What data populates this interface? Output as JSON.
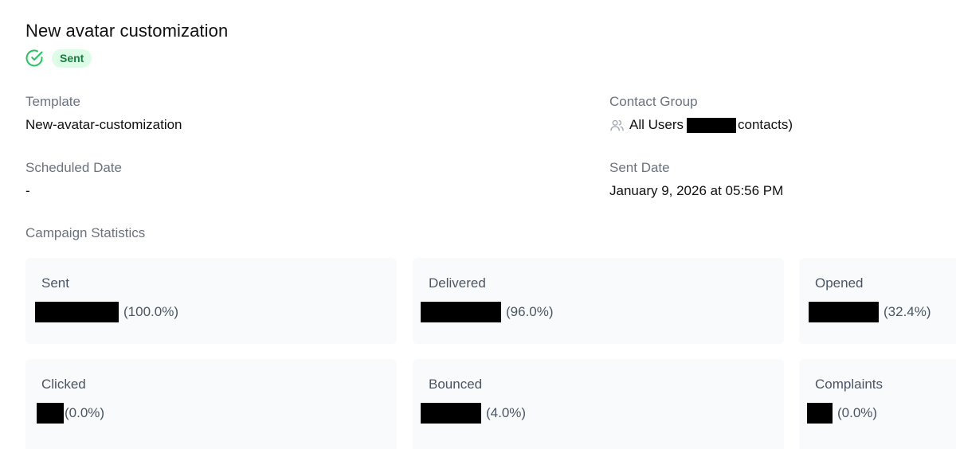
{
  "page": {
    "title": "New avatar customization",
    "status": "Sent"
  },
  "details": {
    "template": {
      "label": "Template",
      "value": "New-avatar-customization"
    },
    "contact_group": {
      "label": "Contact Group",
      "group_name": "All Users",
      "suffix": "contacts)"
    },
    "scheduled_date": {
      "label": "Scheduled Date",
      "value": "-"
    },
    "sent_date": {
      "label": "Sent Date",
      "value": "January 9, 2026 at 05:56 PM"
    }
  },
  "stats": {
    "heading": "Campaign Statistics",
    "cards": [
      {
        "label": "Sent",
        "percent": "(100.0%)"
      },
      {
        "label": "Delivered",
        "percent": "(96.0%)"
      },
      {
        "label": "Opened",
        "percent": "(32.4%)"
      },
      {
        "label": "Clicked",
        "percent": "(0.0%)"
      },
      {
        "label": "Bounced",
        "percent": "(4.0%)"
      },
      {
        "label": "Complaints",
        "percent": "(0.0%)"
      }
    ]
  },
  "colors": {
    "badge_bg": "#dcfce7",
    "badge_text": "#15803d",
    "check_icon": "#22c55e",
    "card_bg": "#f9fafb",
    "muted_text": "#6b7280"
  },
  "icons": {
    "status": "check-circle-icon",
    "contact_group": "users-icon"
  }
}
